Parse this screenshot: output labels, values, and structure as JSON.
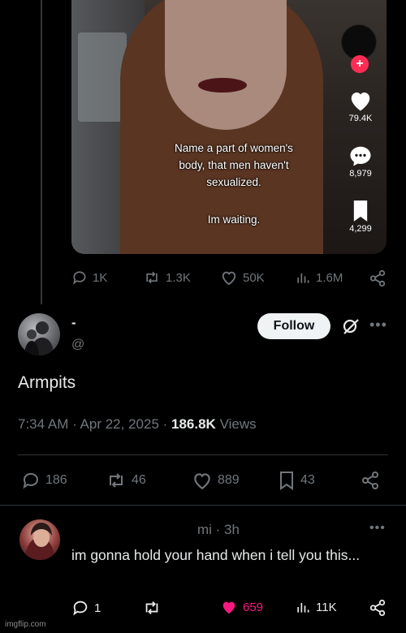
{
  "video": {
    "caption_line1": "Name a part of women's",
    "caption_line2": "body, that men haven't",
    "caption_line3": "sexualized.",
    "caption_line4": "Im waiting.",
    "likes": "79.4K",
    "comments": "8,979",
    "saves": "4,299"
  },
  "quoted_post_stats": {
    "replies": "1K",
    "reposts": "1.3K",
    "likes": "50K",
    "views": "1.6M"
  },
  "reply": {
    "name": "-",
    "handle": "@",
    "follow_label": "Follow",
    "text": "Armpits",
    "timestamp": "7:34 AM · Apr 22, 2025 · ",
    "views_count": "186.8K",
    "views_label": " Views",
    "stats": {
      "replies": "186",
      "reposts": "46",
      "likes": "889",
      "bookmarks": "43"
    }
  },
  "comment": {
    "name_time": "mi · 3h",
    "text": "im gonna hold your hand when i tell you this...",
    "stats": {
      "replies": "1",
      "reposts": "",
      "likes": "659",
      "views": "11K"
    }
  },
  "watermark": "imgflip.com",
  "colors": {
    "background": "#000000",
    "muted": "#71767b",
    "like_active": "#f91880",
    "tiktok_plus": "#fe2c55"
  }
}
